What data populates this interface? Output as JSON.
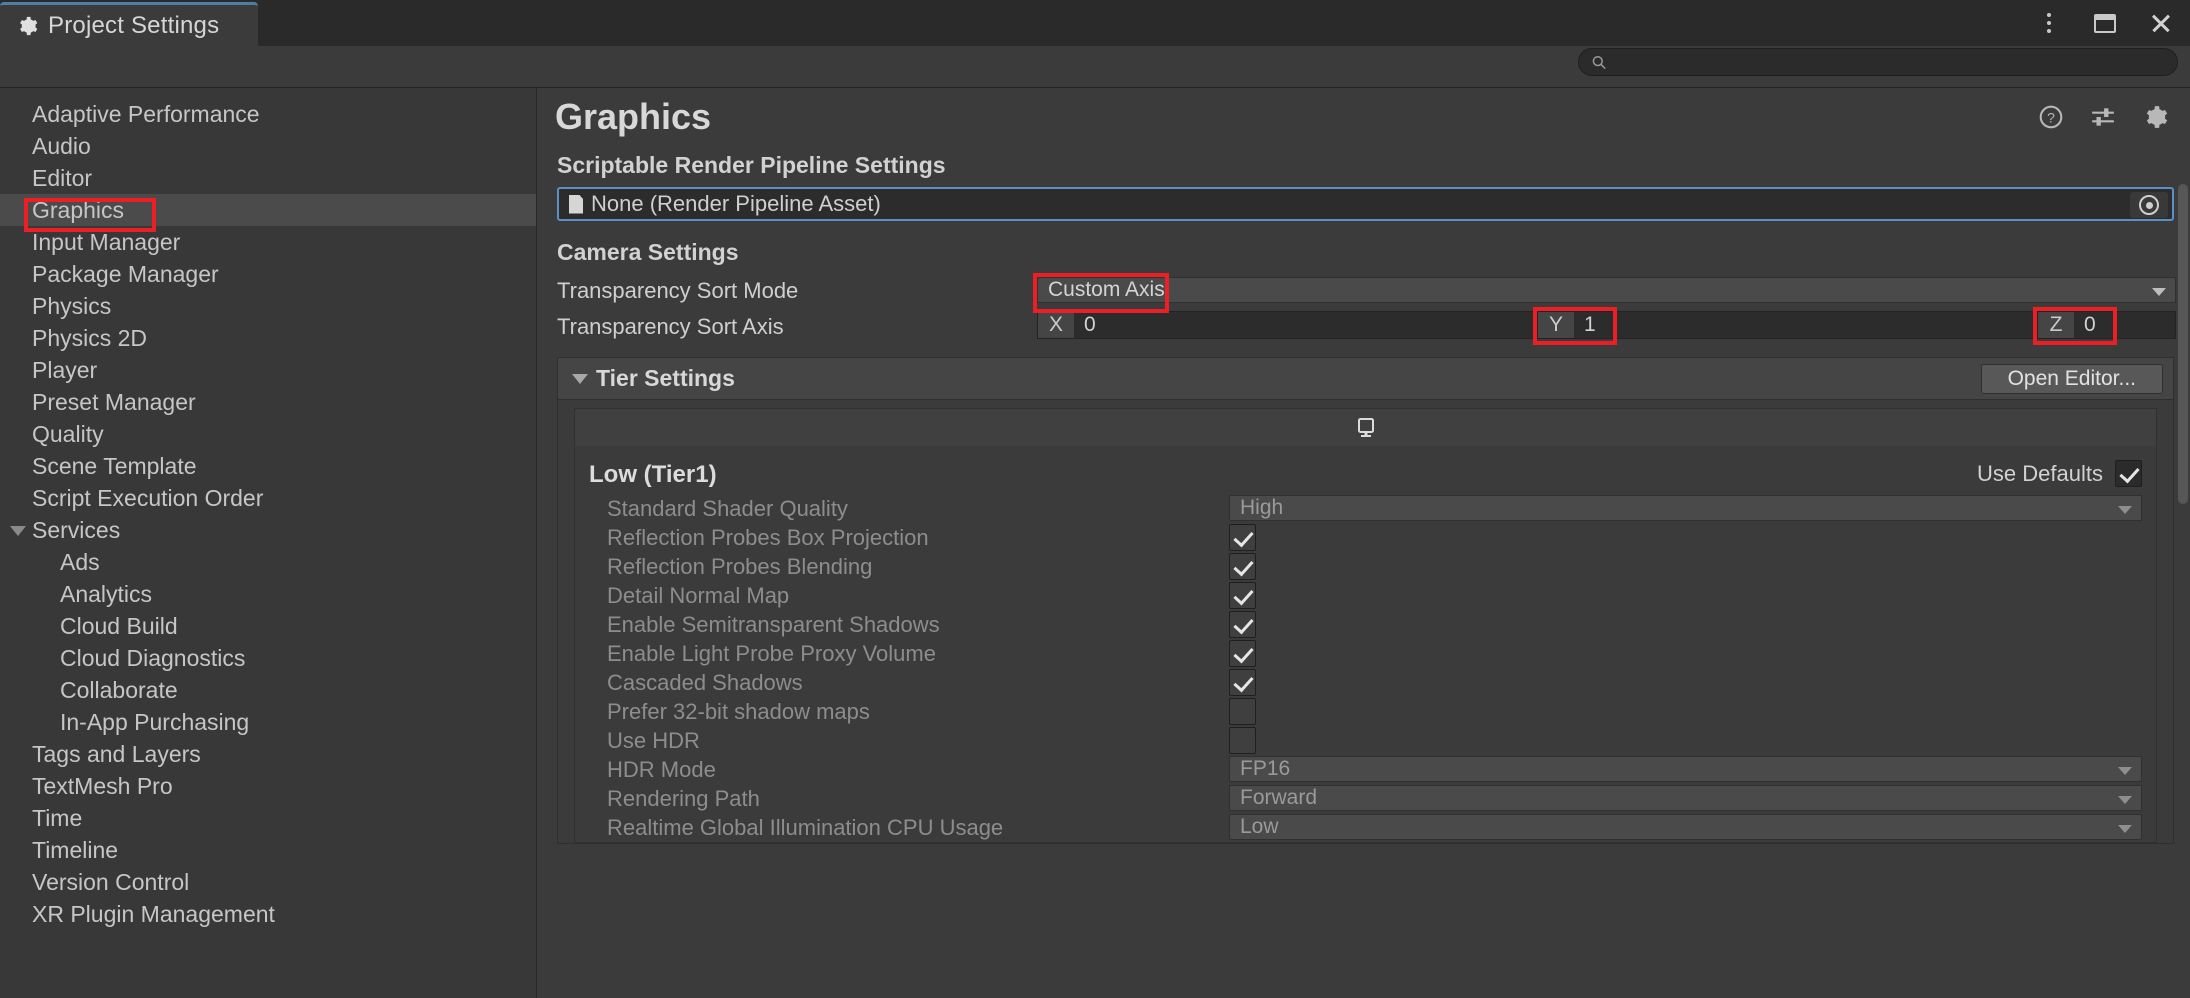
{
  "window": {
    "tab_title": "Project Settings",
    "gear_icon": "gear-icon",
    "controls": {
      "more": "⋮",
      "maximize": "maximize",
      "close": "✕"
    }
  },
  "search": {
    "value": "",
    "placeholder": "",
    "icon": "search-icon"
  },
  "sidebar": {
    "items": [
      {
        "label": "Adaptive Performance",
        "level": 0,
        "selected": false,
        "expandable": false
      },
      {
        "label": "Audio",
        "level": 0,
        "selected": false,
        "expandable": false
      },
      {
        "label": "Editor",
        "level": 0,
        "selected": false,
        "expandable": false
      },
      {
        "label": "Graphics",
        "level": 0,
        "selected": true,
        "expandable": false
      },
      {
        "label": "Input Manager",
        "level": 0,
        "selected": false,
        "expandable": false
      },
      {
        "label": "Package Manager",
        "level": 0,
        "selected": false,
        "expandable": false
      },
      {
        "label": "Physics",
        "level": 0,
        "selected": false,
        "expandable": false
      },
      {
        "label": "Physics 2D",
        "level": 0,
        "selected": false,
        "expandable": false
      },
      {
        "label": "Player",
        "level": 0,
        "selected": false,
        "expandable": false
      },
      {
        "label": "Preset Manager",
        "level": 0,
        "selected": false,
        "expandable": false
      },
      {
        "label": "Quality",
        "level": 0,
        "selected": false,
        "expandable": false
      },
      {
        "label": "Scene Template",
        "level": 0,
        "selected": false,
        "expandable": false
      },
      {
        "label": "Script Execution Order",
        "level": 0,
        "selected": false,
        "expandable": false
      },
      {
        "label": "Services",
        "level": 0,
        "selected": false,
        "expandable": true,
        "expanded": true
      },
      {
        "label": "Ads",
        "level": 1,
        "selected": false,
        "expandable": false
      },
      {
        "label": "Analytics",
        "level": 1,
        "selected": false,
        "expandable": false
      },
      {
        "label": "Cloud Build",
        "level": 1,
        "selected": false,
        "expandable": false
      },
      {
        "label": "Cloud Diagnostics",
        "level": 1,
        "selected": false,
        "expandable": false
      },
      {
        "label": "Collaborate",
        "level": 1,
        "selected": false,
        "expandable": false
      },
      {
        "label": "In-App Purchasing",
        "level": 1,
        "selected": false,
        "expandable": false
      },
      {
        "label": "Tags and Layers",
        "level": 0,
        "selected": false,
        "expandable": false
      },
      {
        "label": "TextMesh Pro",
        "level": 0,
        "selected": false,
        "expandable": false
      },
      {
        "label": "Time",
        "level": 0,
        "selected": false,
        "expandable": false
      },
      {
        "label": "Timeline",
        "level": 0,
        "selected": false,
        "expandable": false
      },
      {
        "label": "Version Control",
        "level": 0,
        "selected": false,
        "expandable": false
      },
      {
        "label": "XR Plugin Management",
        "level": 0,
        "selected": false,
        "expandable": false
      }
    ]
  },
  "main": {
    "page_title": "Graphics",
    "head_icons": [
      "help-icon",
      "preset-icon",
      "gear-icon"
    ],
    "srp": {
      "section_title": "Scriptable Render Pipeline Settings",
      "asset_value": "None (Render Pipeline Asset)",
      "picker_icon": "object-picker-icon"
    },
    "camera": {
      "section_title": "Camera Settings",
      "sort_mode_label": "Transparency Sort Mode",
      "sort_mode_value": "Custom Axis",
      "sort_axis_label": "Transparency Sort Axis",
      "axis": [
        {
          "tag": "X",
          "value": "0",
          "highlighted": false
        },
        {
          "tag": "Y",
          "value": "1",
          "highlighted": true
        },
        {
          "tag": "Z",
          "value": "0",
          "highlighted": true
        }
      ]
    },
    "tier": {
      "header_label": "Tier Settings",
      "open_editor_label": "Open Editor...",
      "platform_icon": "desktop-monitor-icon",
      "tier_label": "Low (Tier1)",
      "use_defaults_label": "Use Defaults",
      "use_defaults_checked": true,
      "rows": [
        {
          "label": "Standard Shader Quality",
          "type": "dropdown",
          "value": "High"
        },
        {
          "label": "Reflection Probes Box Projection",
          "type": "checkbox",
          "checked": true
        },
        {
          "label": "Reflection Probes Blending",
          "type": "checkbox",
          "checked": true
        },
        {
          "label": "Detail Normal Map",
          "type": "checkbox",
          "checked": true
        },
        {
          "label": "Enable Semitransparent Shadows",
          "type": "checkbox",
          "checked": true
        },
        {
          "label": "Enable Light Probe Proxy Volume",
          "type": "checkbox",
          "checked": true
        },
        {
          "label": "Cascaded Shadows",
          "type": "checkbox",
          "checked": true
        },
        {
          "label": "Prefer 32-bit shadow maps",
          "type": "checkbox",
          "checked": false
        },
        {
          "label": "Use HDR",
          "type": "checkbox",
          "checked": false
        },
        {
          "label": "HDR Mode",
          "type": "dropdown",
          "value": "FP16"
        },
        {
          "label": "Rendering Path",
          "type": "dropdown",
          "value": "Forward"
        },
        {
          "label": "Realtime Global Illumination CPU Usage",
          "type": "dropdown",
          "value": "Low"
        }
      ]
    }
  },
  "annotations": {
    "color": "#ec2024",
    "boxes": [
      "graphics-nav-item",
      "custom-axis-dropdown",
      "axis-y-field",
      "axis-z-field"
    ]
  }
}
